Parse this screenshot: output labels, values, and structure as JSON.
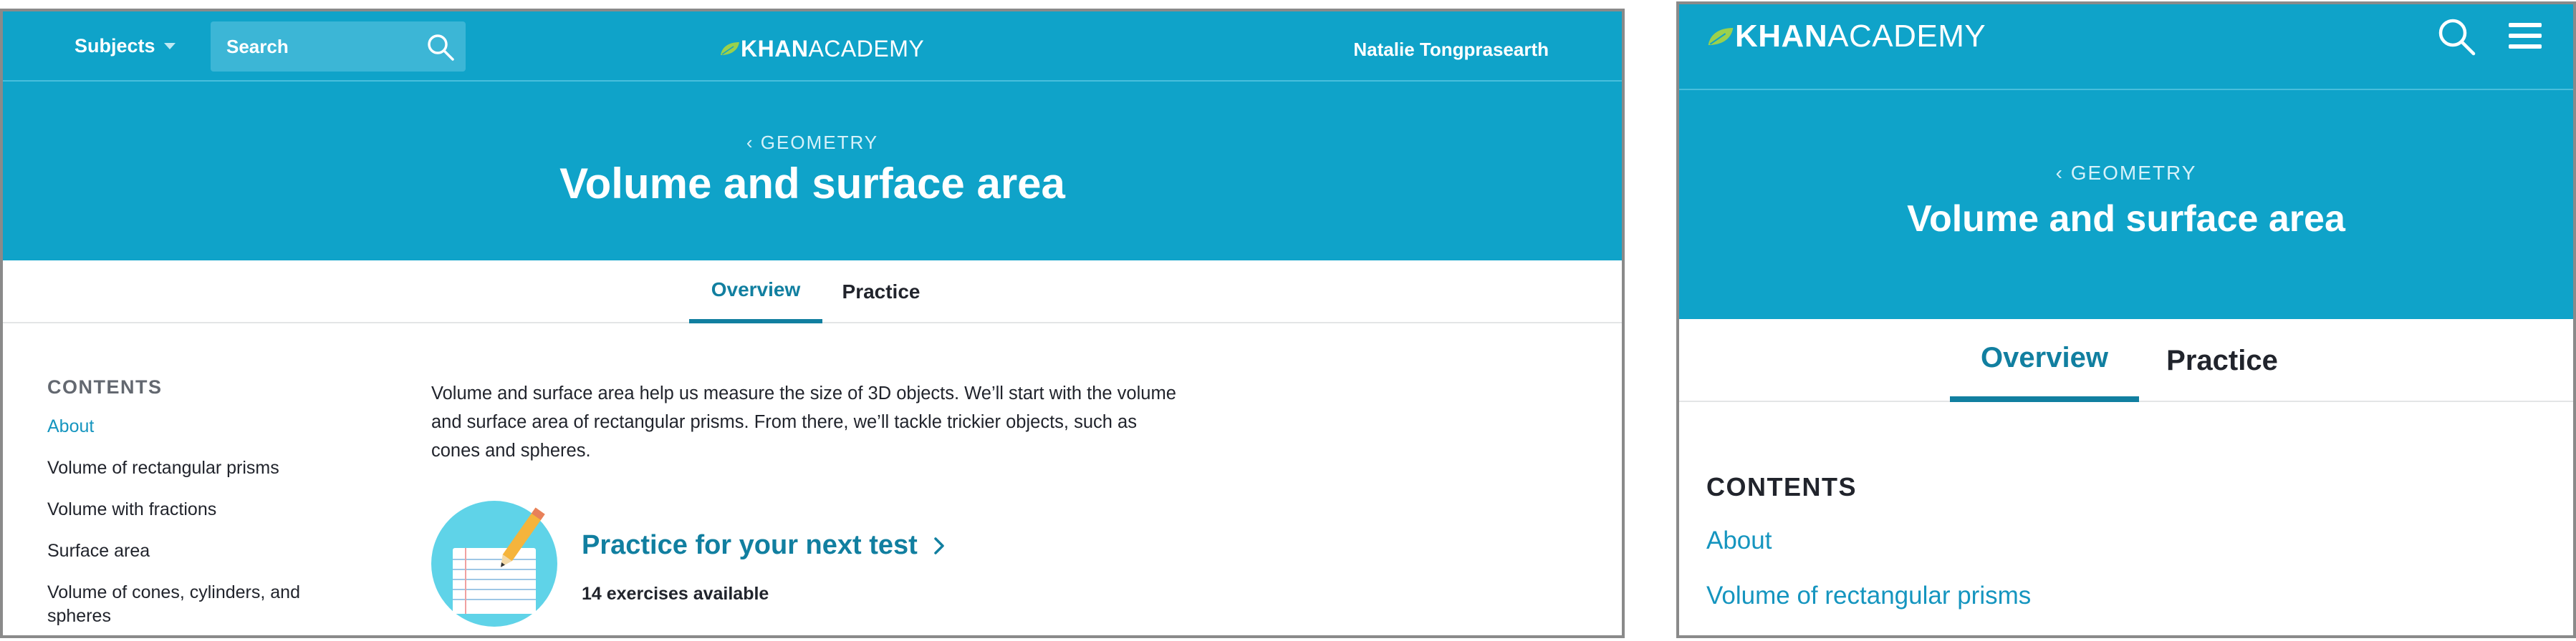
{
  "colors": {
    "brand_blue": "#0fa3c9",
    "link_blue": "#1595bf",
    "tab_active": "#117fa0",
    "logo_leaf": "#9bd14c"
  },
  "desktop": {
    "nav": {
      "subjects_label": "Subjects",
      "search_placeholder": "Search",
      "logo_bold": "KHAN",
      "logo_light": "ACADEMY",
      "user_name": "Natalie Tongprasearth"
    },
    "hero": {
      "breadcrumb": "GEOMETRY",
      "title": "Volume and surface area"
    },
    "tabs": [
      "Overview",
      "Practice"
    ],
    "contents": {
      "heading": "CONTENTS",
      "items": [
        "About",
        "Volume of rectangular prisms",
        "Volume with fractions",
        "Surface area",
        "Volume of cones, cylinders, and spheres"
      ]
    },
    "description": "Volume and surface area help us measure the size of 3D objects. We’ll start with the volume and surface area of rectangular prisms. From there, we’ll tackle trickier objects, such as cones and spheres.",
    "practice": {
      "title": "Practice for your next test",
      "count": "14 exercises available"
    }
  },
  "mobile": {
    "nav": {
      "logo_bold": "KHAN",
      "logo_light": "ACADEMY"
    },
    "hero": {
      "breadcrumb": "GEOMETRY",
      "title": "Volume and surface area"
    },
    "tabs": [
      "Overview",
      "Practice"
    ],
    "contents": {
      "heading": "CONTENTS",
      "items": [
        "About",
        "Volume of rectangular prisms"
      ]
    }
  }
}
